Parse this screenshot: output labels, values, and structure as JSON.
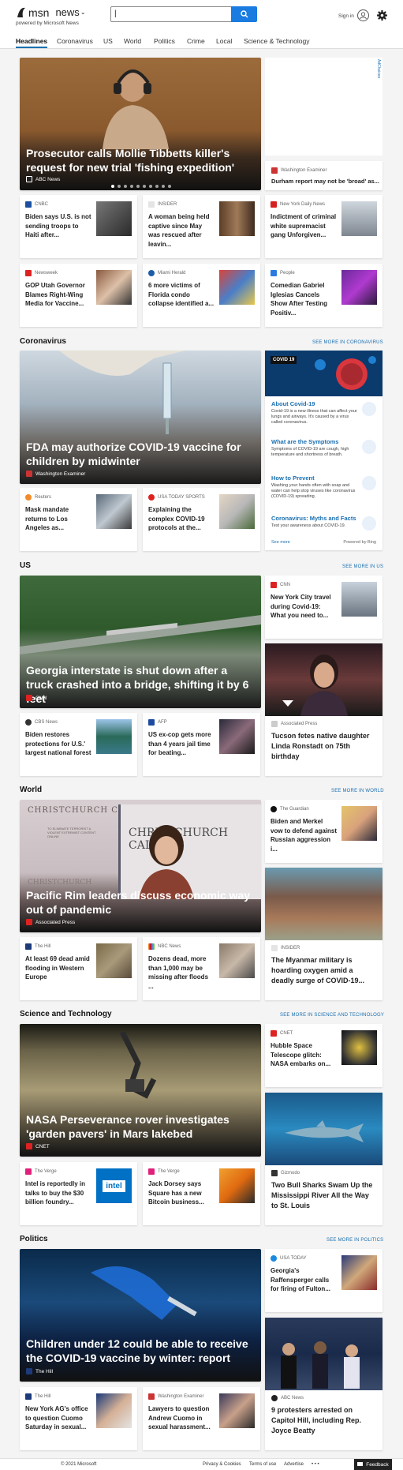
{
  "header": {
    "brand": "msn",
    "section": "news",
    "powered_by": "powered by Microsoft News",
    "search_value": "|",
    "sign_in": "Sign in"
  },
  "nav": {
    "items": [
      "Headlines",
      "Coronavirus",
      "US",
      "World",
      "Politics",
      "Crime",
      "Local",
      "Science & Technology"
    ],
    "active": "Headlines"
  },
  "top": {
    "hero": {
      "title": "Prosecutor calls Mollie Tibbetts killer's request for new trial 'fishing expedition'",
      "source": "ABC News"
    },
    "ad_label": "AdChoices",
    "side_card": {
      "source": "Washington Examiner",
      "title": "Durham report may not be 'broad' as..."
    },
    "row1": [
      {
        "source": "CNBC",
        "title": "Biden says U.S. is not sending troops to Haiti after..."
      },
      {
        "source": "INSIDER",
        "title": "A woman being held captive since May was rescued after leavin..."
      },
      {
        "source": "New York Daily News",
        "title": "Indictment of criminal white supremacist gang Unforgiven..."
      }
    ],
    "row2": [
      {
        "source": "Newsweek",
        "title": "GOP Utah Governor Blames Right-Wing Media for Vaccine..."
      },
      {
        "source": "Miami Herald",
        "title": "6 more victims of Florida condo collapse identified a..."
      },
      {
        "source": "People",
        "title": "Comedian Gabriel Iglesias Cancels Show After Testing Positiv..."
      }
    ]
  },
  "coronavirus": {
    "title": "Coronavirus",
    "see_more": "SEE MORE IN CORONAVIRUS",
    "hero": {
      "title": "FDA may authorize COVID-19 vaccine for children by midwinter",
      "source": "Washington Examiner"
    },
    "small": [
      {
        "source": "Reuters",
        "title": "Mask mandate returns to Los Angeles as..."
      },
      {
        "source": "USA TODAY SPORTS",
        "title": "Explaining the complex COVID-19 protocols at the..."
      }
    ],
    "panel": {
      "tag": "COVID 19",
      "items": [
        {
          "heading": "About Covid-19",
          "desc": "Covid-19 is a new illness that can affect your lungs and airways. It's caused by a virus called coronavirus."
        },
        {
          "heading": "What are the Symptoms",
          "desc": "Symptoms of COVID-19 are cough, high temperature and shortness of breath."
        },
        {
          "heading": "How to Prevent",
          "desc": "Washing your hands often with soap and water can help stop viruses like coronavirus (COVID-19) spreading."
        },
        {
          "heading": "Coronavirus: Myths and Facts",
          "desc": "Test your awareness about COVID-19."
        }
      ],
      "see_more": "See more",
      "powered": "Powered by Bing"
    }
  },
  "us": {
    "title": "US",
    "see_more": "SEE MORE IN US",
    "hero": {
      "title": "Georgia interstate is shut down after a truck crashed into a bridge, shifting it by 6 feet",
      "source": "CNN"
    },
    "side_small": {
      "source": "CNN",
      "title": "New York City travel during Covid-19: What you need to..."
    },
    "small": [
      {
        "source": "CBS News",
        "title": "Biden restores protections for U.S.' largest national forest"
      },
      {
        "source": "AFP",
        "title": "US ex-cop gets more than 4 years jail time for beating..."
      }
    ],
    "tall": {
      "source": "Associated Press",
      "title": "Tucson fetes native daughter Linda Ronstadt on 75th birthday"
    }
  },
  "world": {
    "title": "World",
    "see_more": "SEE MORE IN WORLD",
    "hero": {
      "title": "Pacific Rim leaders discuss economic way out of pandemic",
      "source": "Associated Press"
    },
    "hero_sign": [
      "CHRISTCHURCH CALL",
      "TO ELIMINATE TERRORIST & VIOLENT EXTREMIST CONTENT ONLINE",
      "CHRISTCHURCH",
      "CALL"
    ],
    "side_small": {
      "source": "The Guardian",
      "title": "Biden and Merkel vow to defend against Russian aggression i..."
    },
    "small": [
      {
        "source": "The Hill",
        "title": "At least 69 dead amid flooding in Western Europe"
      },
      {
        "source": "NBC News",
        "title": "Dozens dead, more than 1,000 may be missing after floods ..."
      }
    ],
    "tall": {
      "source": "INSIDER",
      "title": "The Myanmar military is hoarding oxygen amid a deadly surge of COVID-19..."
    }
  },
  "scitech": {
    "title": "Science and Technology",
    "see_more": "SEE MORE IN SCIENCE AND TECHNOLOGY",
    "hero": {
      "title": "NASA Perseverance rover investigates 'garden pavers' in Mars lakebed",
      "source": "CNET"
    },
    "side_small": {
      "source": "CNET",
      "title": "Hubble Space Telescope glitch: NASA embarks on..."
    },
    "small": [
      {
        "source": "The Verge",
        "title": "Intel is reportedly in talks to buy the $30 billion foundry..."
      },
      {
        "source": "The Verge",
        "title": "Jack Dorsey says Square has a new Bitcoin business..."
      }
    ],
    "intel_logo": "intel",
    "tall": {
      "source": "Gizmodo",
      "title": "Two Bull Sharks Swam Up the Mississippi River All the Way to St. Louis"
    }
  },
  "politics": {
    "title": "Politics",
    "see_more": "SEE MORE IN POLITICS",
    "hero": {
      "title": "Children under 12 could be able to receive the COVID-19 vaccine by winter: report",
      "source": "The Hill"
    },
    "side_small": {
      "source": "USA TODAY",
      "title": "Georgia's Raffensperger calls for firing of Fulton..."
    },
    "small": [
      {
        "source": "The Hill",
        "title": "New York AG's office to question Cuomo Saturday in sexual..."
      },
      {
        "source": "Washington Examiner",
        "title": "Lawyers to question Andrew Cuomo in sexual harassment..."
      }
    ],
    "tall": {
      "source": "ABC News",
      "title": "9 protesters arrested on Capitol Hill, including Rep. Joyce Beatty"
    }
  },
  "footer": {
    "copyright": "© 2021 Microsoft",
    "privacy": "Privacy & Cookies",
    "terms": "Terms of use",
    "advertise": "Advertise",
    "more": "• • •",
    "feedback": "Feedback"
  }
}
